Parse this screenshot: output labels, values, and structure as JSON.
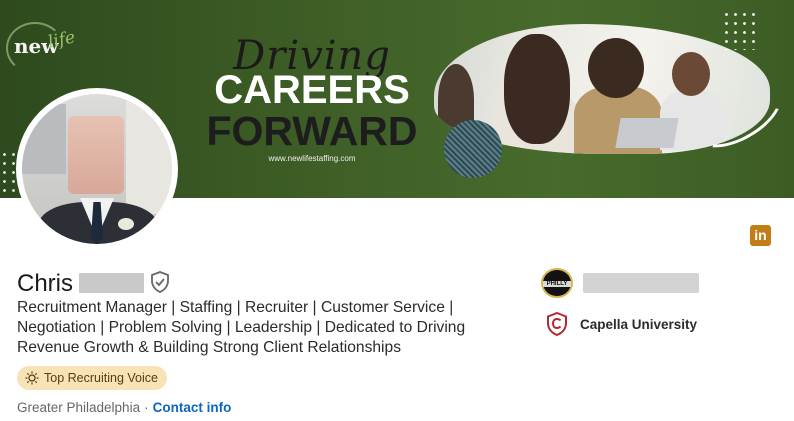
{
  "banner": {
    "logo_new": "new",
    "logo_life": "life",
    "headline_driving": "Driving",
    "headline_careers": "CAREERS",
    "headline_forward": "FORWARD",
    "website": "www.newlifestaffing.com"
  },
  "profile": {
    "first_name": "Chris",
    "headline": "Recruitment Manager | Staffing | Recruiter | Customer Service | Negotiation | Problem Solving | Leadership | Dedicated to Driving Revenue Growth & Building Strong Client Relationships",
    "badge_label": "Top Recruiting Voice",
    "location": "Greater Philadelphia",
    "separator": "·",
    "contact_link": "Contact info"
  },
  "sidebar": {
    "linkedin_icon_text": "in",
    "current_company_logo_text": "PHILLY",
    "education_name": "Capella University"
  },
  "colors": {
    "brand_blue": "#0a66c2",
    "banner_green": "#3e5e26",
    "badge_bg": "#f8e3b6",
    "linkedin_orange": "#c37d16",
    "capella_red": "#b3272d"
  },
  "icons": [
    "verified-shield-icon",
    "lightbulb-icon",
    "linkedin-icon",
    "capella-logo-icon",
    "philly-logo-icon"
  ]
}
